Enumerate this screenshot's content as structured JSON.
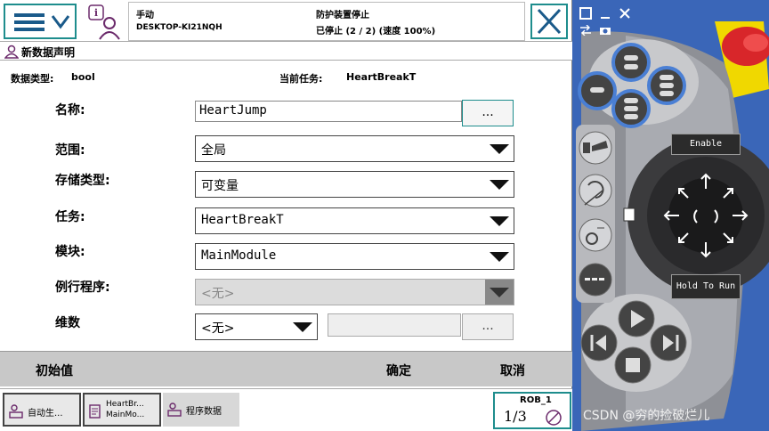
{
  "header": {
    "mode": "手动",
    "host": "DESKTOP-KI21NQH",
    "safety_status": "防护装置停止",
    "run_status": "已停止 (2 / 2) (速度 100%)"
  },
  "title": "新数据声明",
  "info": {
    "type_label": "数据类型:",
    "type_value": "bool",
    "task_label": "当前任务:",
    "task_value": "HeartBreakT"
  },
  "form": {
    "name_label": "名称:",
    "name_value": "HeartJump",
    "name_button": "...",
    "scope_label": "范围:",
    "scope_value": "全局",
    "storage_label": "存储类型:",
    "storage_value": "可变量",
    "task_label": "任务:",
    "task_value": "HeartBreakT",
    "module_label": "模块:",
    "module_value": "MainModule",
    "routine_label": "例行程序:",
    "routine_value": "<无>",
    "dim_label": "维数",
    "dim_value": "<无>",
    "dim_button": "..."
  },
  "actions": {
    "initial": "初始值",
    "ok": "确定",
    "cancel": "取消"
  },
  "taskbar": {
    "task1": "自动生...",
    "task2_line1": "HeartBr...",
    "task2_line2": "MainMo...",
    "task3": "程序数据",
    "rob_label": "ROB_1",
    "rob_fraction": "1/3"
  },
  "flexpendant": {
    "enable_label": "Enable",
    "hold_label": "Hold To Run"
  },
  "watermark": "CSDN @穷的捡破烂儿",
  "colors": {
    "accent": "#1e8d8d",
    "panel_blue": "#3a66b8",
    "action_bar": "#c8c8c8",
    "estop_red": "#d8262a",
    "estop_yellow": "#f0d800"
  }
}
